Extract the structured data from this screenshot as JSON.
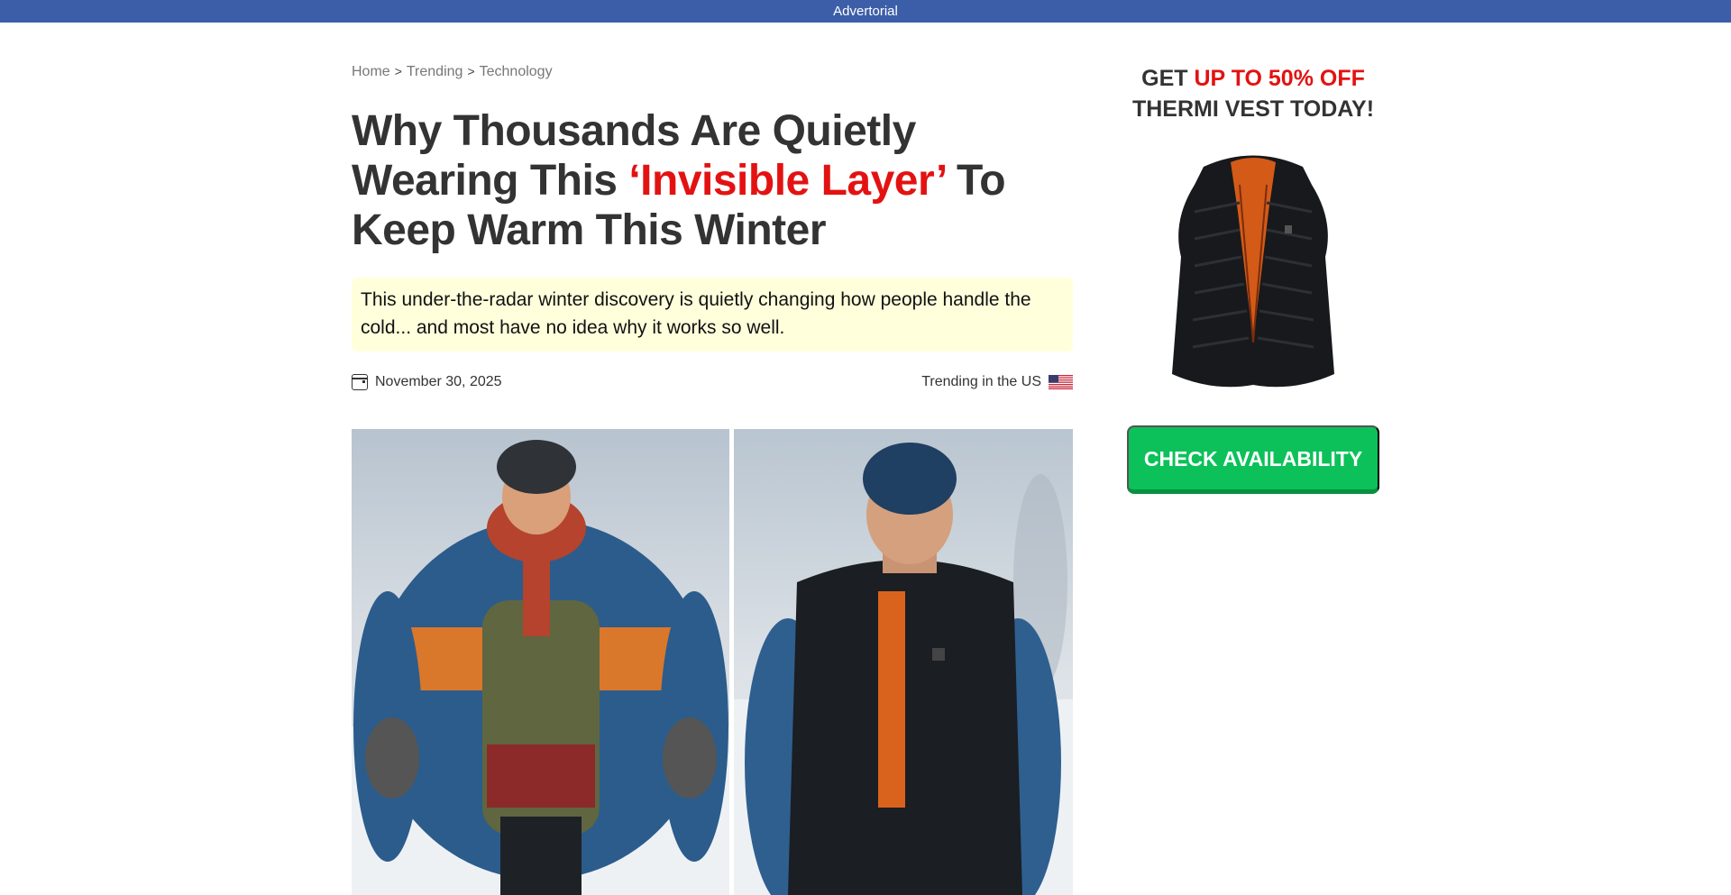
{
  "top_banner": {
    "label": "Advertorial"
  },
  "breadcrumb": [
    {
      "label": "Home"
    },
    {
      "label": "Trending"
    },
    {
      "label": "Technology"
    }
  ],
  "breadcrumb_separator": ">",
  "headline": {
    "part1": "Why Thousands Are Quietly Wearing This ",
    "highlight": "‘Invisible Layer’",
    "part2": " To Keep Warm This Winter"
  },
  "summary": "This under-the-radar winter discovery is quietly changing how people handle the cold... and most have no idea why it works so well.",
  "meta": {
    "date": "November 30, 2025",
    "trending": "Trending in the US"
  },
  "sidebar": {
    "promo_prefix": "GET ",
    "promo_highlight": "UP TO 50% OFF",
    "promo_line2": "THERMI VEST TODAY!",
    "cta_label": "CHECK AVAILABILITY"
  },
  "colors": {
    "banner": "#3c5ea8",
    "highlight": "#e31212",
    "summary_bg": "#ffffdc",
    "cta": "#0cc15a"
  },
  "icons": [
    "calendar-icon",
    "us-flag-icon"
  ]
}
